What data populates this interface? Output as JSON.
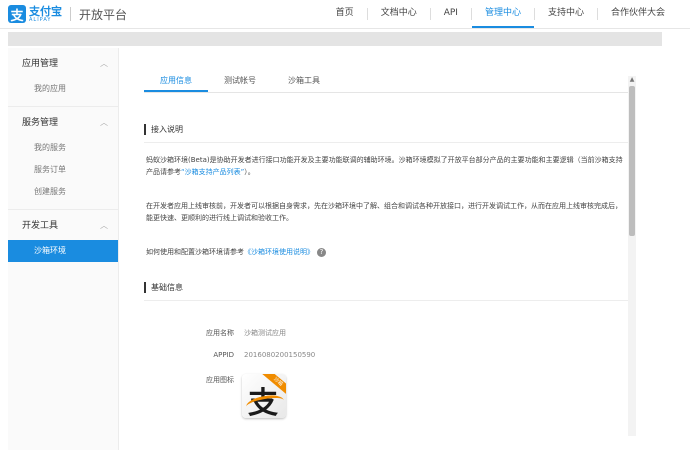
{
  "header": {
    "logo_mark": "支",
    "logo_cn": "支付宝",
    "logo_en": "ALIPAY",
    "platform": "开放平台",
    "nav": [
      {
        "label": "首页",
        "active": false
      },
      {
        "label": "文档中心",
        "active": false
      },
      {
        "label": "API",
        "active": false
      },
      {
        "label": "管理中心",
        "active": true
      },
      {
        "label": "支持中心",
        "active": false
      },
      {
        "label": "合作伙伴大会",
        "active": false
      }
    ]
  },
  "sidebar": {
    "groups": [
      {
        "title": "应用管理",
        "items": [
          "我的应用"
        ]
      },
      {
        "title": "服务管理",
        "items": [
          "我的服务",
          "服务订单",
          "创建服务"
        ]
      },
      {
        "title": "开发工具",
        "items": [
          "沙箱环境"
        ]
      }
    ],
    "active_item": "沙箱环境"
  },
  "main": {
    "tabs": [
      {
        "label": "应用信息",
        "active": true
      },
      {
        "label": "测试帐号",
        "active": false
      },
      {
        "label": "沙箱工具",
        "active": false
      }
    ],
    "intro": {
      "title": "接入说明",
      "p1_text": "蚂蚁沙箱环境(Beta)是协助开发者进行接口功能开发及主要功能联调的辅助环境。沙箱环境模拟了开放平台部分产品的主要功能和主要逻辑（当前沙箱支持产品请参考",
      "p1_link": "“沙箱支持产品列表”",
      "p1_end": "）。",
      "p2_text": "在开发者应用上线审核前，开发者可以根据自身需求，先在沙箱环境中了解、组合和调试各种开放接口，进行开发调试工作，从而在应用上线审核完成后，能更快速、更顺利的进行线上调试和验收工作。",
      "p3_text": "如何使用和配置沙箱环境请参考",
      "p3_link": "《沙箱环境使用说明》",
      "help_icon": "?"
    },
    "basic": {
      "title": "基础信息",
      "app_name_label": "应用名称",
      "app_name_value": "沙箱测试应用",
      "appid_label": "APPID",
      "appid_value": "2016080200150590",
      "app_icon_label": "应用图标",
      "app_icon_glyph": "支",
      "app_icon_ribbon": "沙箱"
    }
  },
  "scrollbar": {
    "up_glyph": "▲"
  }
}
